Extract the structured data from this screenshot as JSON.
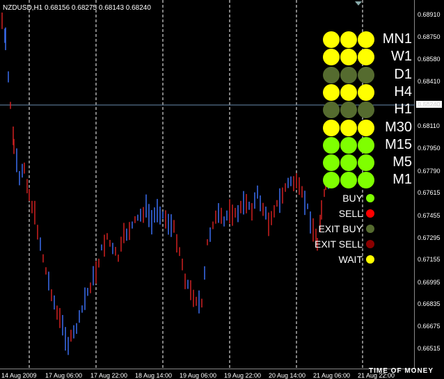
{
  "chart_title": "NZDUSD,H1  0.68156 0.68275 0.68143 0.68240",
  "current_price": "0.68240",
  "price_ticks": [
    "0.68910",
    "0.68750",
    "0.68580",
    "0.68410",
    "0.68240",
    "0.68110",
    "0.67950",
    "0.67790",
    "0.67615",
    "0.67455",
    "0.67295",
    "0.67155",
    "0.66995",
    "0.66835",
    "0.66675",
    "0.66515"
  ],
  "time_ticks": [
    "14 Aug 2009",
    "17 Aug 06:00",
    "17 Aug 22:00",
    "18 Aug 14:00",
    "19 Aug 06:00",
    "19 Aug 22:00",
    "20 Aug 14:00",
    "21 Aug 06:00",
    "21 Aug 22:00"
  ],
  "timeframes": [
    {
      "label": "MN1",
      "color": "#ffff00"
    },
    {
      "label": "W1",
      "color": "#ffff00"
    },
    {
      "label": "D1",
      "color": "#556b2f"
    },
    {
      "label": "H4",
      "color": "#ffff00"
    },
    {
      "label": "H1",
      "color": "#556b2f"
    },
    {
      "label": "M30",
      "color": "#ffff00"
    },
    {
      "label": "M15",
      "color": "#7fff00"
    },
    {
      "label": "M5",
      "color": "#7fff00"
    },
    {
      "label": "M1",
      "color": "#7fff00"
    }
  ],
  "legend": [
    {
      "label": "BUY",
      "color": "#7fff00"
    },
    {
      "label": "SELL",
      "color": "#ff0000"
    },
    {
      "label": "EXIT BUY",
      "color": "#556b2f"
    },
    {
      "label": "EXIT SELL",
      "color": "#8b0000"
    },
    {
      "label": "WAIT",
      "color": "#ffff00"
    }
  ],
  "watermark": "TIME OF MONEY",
  "colors": {
    "bull_bar": "#3a6df0",
    "bear_bar": "#d02020",
    "grid": "#ffffff",
    "current_line": "#6a8caf"
  }
}
